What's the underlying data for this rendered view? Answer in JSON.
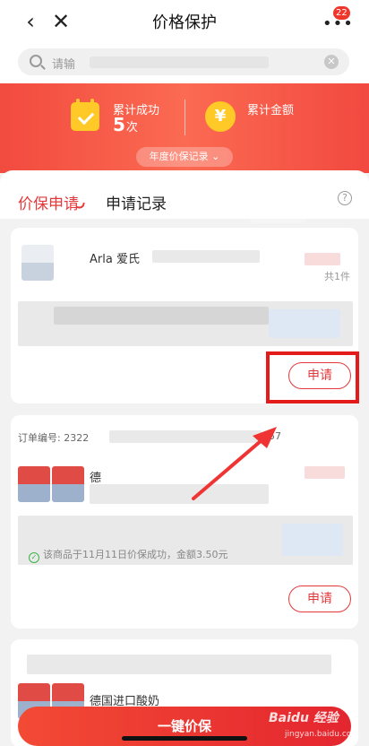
{
  "nav": {
    "title": "价格保护",
    "back_icon": "‹",
    "close_icon": "✕",
    "more_icon": "•••",
    "badge": "22"
  },
  "search": {
    "placeholder": "请输"
  },
  "stats": {
    "success_label": "累计成功",
    "success_count": "5",
    "success_unit": "次",
    "amount_label": "累计金额",
    "year_record": "年度价保记录 ⌄"
  },
  "tabs": {
    "active": "价保申请",
    "inactive": "申请记录",
    "help_icon": "?"
  },
  "card1": {
    "title_prefix": "Arla 爱氏",
    "count": "共1件",
    "apply_label": "申请"
  },
  "card2": {
    "order_label": "订单编号: 2322",
    "order_time": "57",
    "title_prefix": "德",
    "success_text": "该商品于11月11日价保成功，金额3.50元",
    "apply_label": "申请"
  },
  "card3": {
    "title_prefix": "德国进口酸奶"
  },
  "bottom": {
    "one_click_label": "一键价保"
  },
  "watermark": {
    "main": "Baidu 经验",
    "sub": "jingyan.baidu.com"
  },
  "colors": {
    "accent": "#e4393c",
    "banner": "#f24b3f",
    "gold": "#ffc928"
  }
}
